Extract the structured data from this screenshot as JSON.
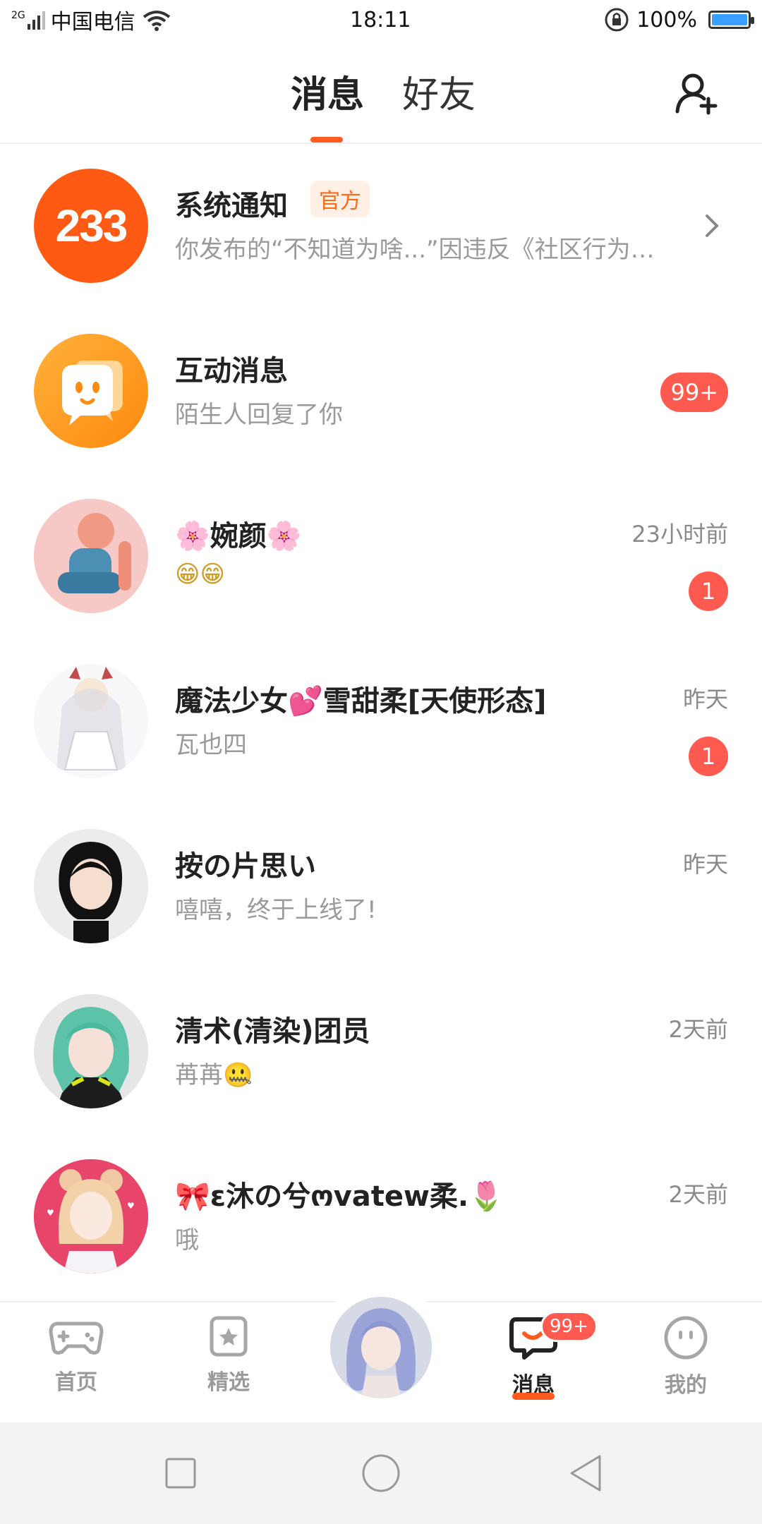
{
  "status_bar": {
    "network": "2G",
    "carrier": "中国电信",
    "time": "18:11",
    "battery": "100%"
  },
  "header": {
    "tabs": [
      {
        "label": "消息",
        "active": true
      },
      {
        "label": "好友",
        "active": false
      }
    ],
    "accent_color": "#ff5a1f"
  },
  "messages": [
    {
      "title": "系统通知",
      "tag": "官方",
      "preview": "你发布的“不知道为啥...”因违反《社区行为守...",
      "time": "",
      "badge": ""
    },
    {
      "title": "互动消息",
      "preview": "陌生人回复了你",
      "time": "",
      "badge": "99+"
    },
    {
      "title": "🌸婉颜🌸",
      "preview": "😁😁",
      "time": "23小时前",
      "badge": "1"
    },
    {
      "title": "魔法少女💕雪甜柔[天使形态]",
      "preview": "瓦也四",
      "time": "昨天",
      "badge": "1"
    },
    {
      "title": "按の片思い",
      "preview": "嘻嘻，终于上线了!",
      "time": "昨天",
      "badge": ""
    },
    {
      "title": "清术(清染)团员",
      "preview": "苒苒🤐",
      "time": "2天前",
      "badge": ""
    },
    {
      "title": "🎀ε沐の兮ოvatew柔.🌷",
      "preview": "哦",
      "time": "2天前",
      "badge": ""
    }
  ],
  "tabbar": {
    "items": [
      {
        "label": "首页",
        "icon": "gamepad-icon"
      },
      {
        "label": "精选",
        "icon": "star-box-icon"
      },
      {
        "label": "",
        "icon": "center-avatar"
      },
      {
        "label": "消息",
        "icon": "chat-icon",
        "badge": "99+",
        "active": true
      },
      {
        "label": "我的",
        "icon": "face-icon"
      }
    ]
  }
}
